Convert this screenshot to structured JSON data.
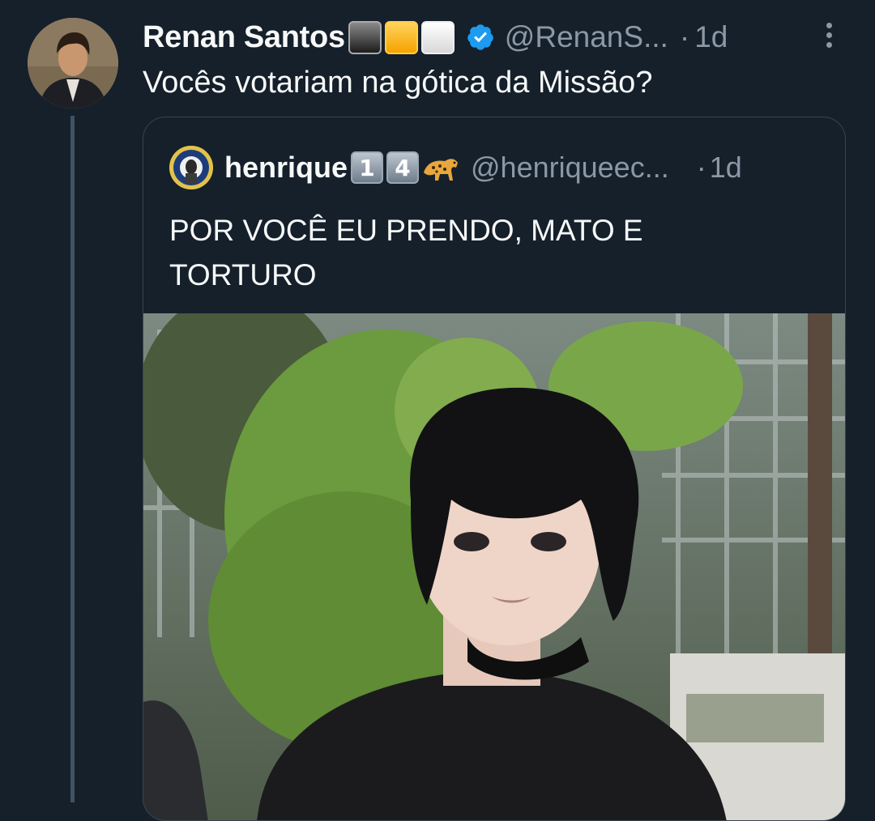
{
  "tweet": {
    "author_name": "Renan Santos",
    "author_handle": "@RenanS...",
    "separator": "·",
    "time": "1d",
    "text": "Vocês votariam na gótica da Missão?",
    "name_emoji": [
      "black-square",
      "yellow-square",
      "white-square"
    ],
    "verified_color": "#1d9bf0"
  },
  "quote": {
    "author_name": "henrique",
    "name_keycaps": [
      "1",
      "4"
    ],
    "name_emoji_extra": "leopard",
    "author_handle": "@henriqueec...",
    "separator": "·",
    "time": "1d",
    "text": "POR VOCÊ EU PRENDO, MATO E TORTURO"
  },
  "colors": {
    "background": "#15202b",
    "text_primary": "#f7f9f9",
    "text_secondary": "#8b98a5",
    "border": "#38444d"
  }
}
